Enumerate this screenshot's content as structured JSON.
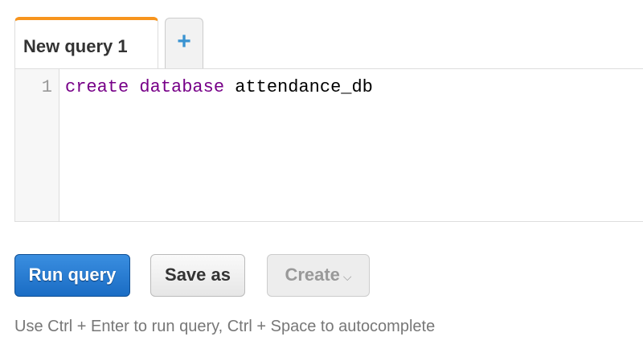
{
  "tabs": [
    {
      "label": "New query 1",
      "active": true
    }
  ],
  "add_tab_label": "+",
  "editor": {
    "line_numbers": [
      "1"
    ],
    "keywords": [
      "create",
      "database"
    ],
    "identifier": "attendance_db"
  },
  "buttons": {
    "run": "Run query",
    "save": "Save as",
    "create": "Create",
    "create_chevron": "⌵"
  },
  "hint": "Use Ctrl + Enter to run query, Ctrl + Space to autocomplete",
  "colors": {
    "accent": "#f7941d",
    "primary": "#1a6cc4",
    "keyword": "#770088"
  }
}
